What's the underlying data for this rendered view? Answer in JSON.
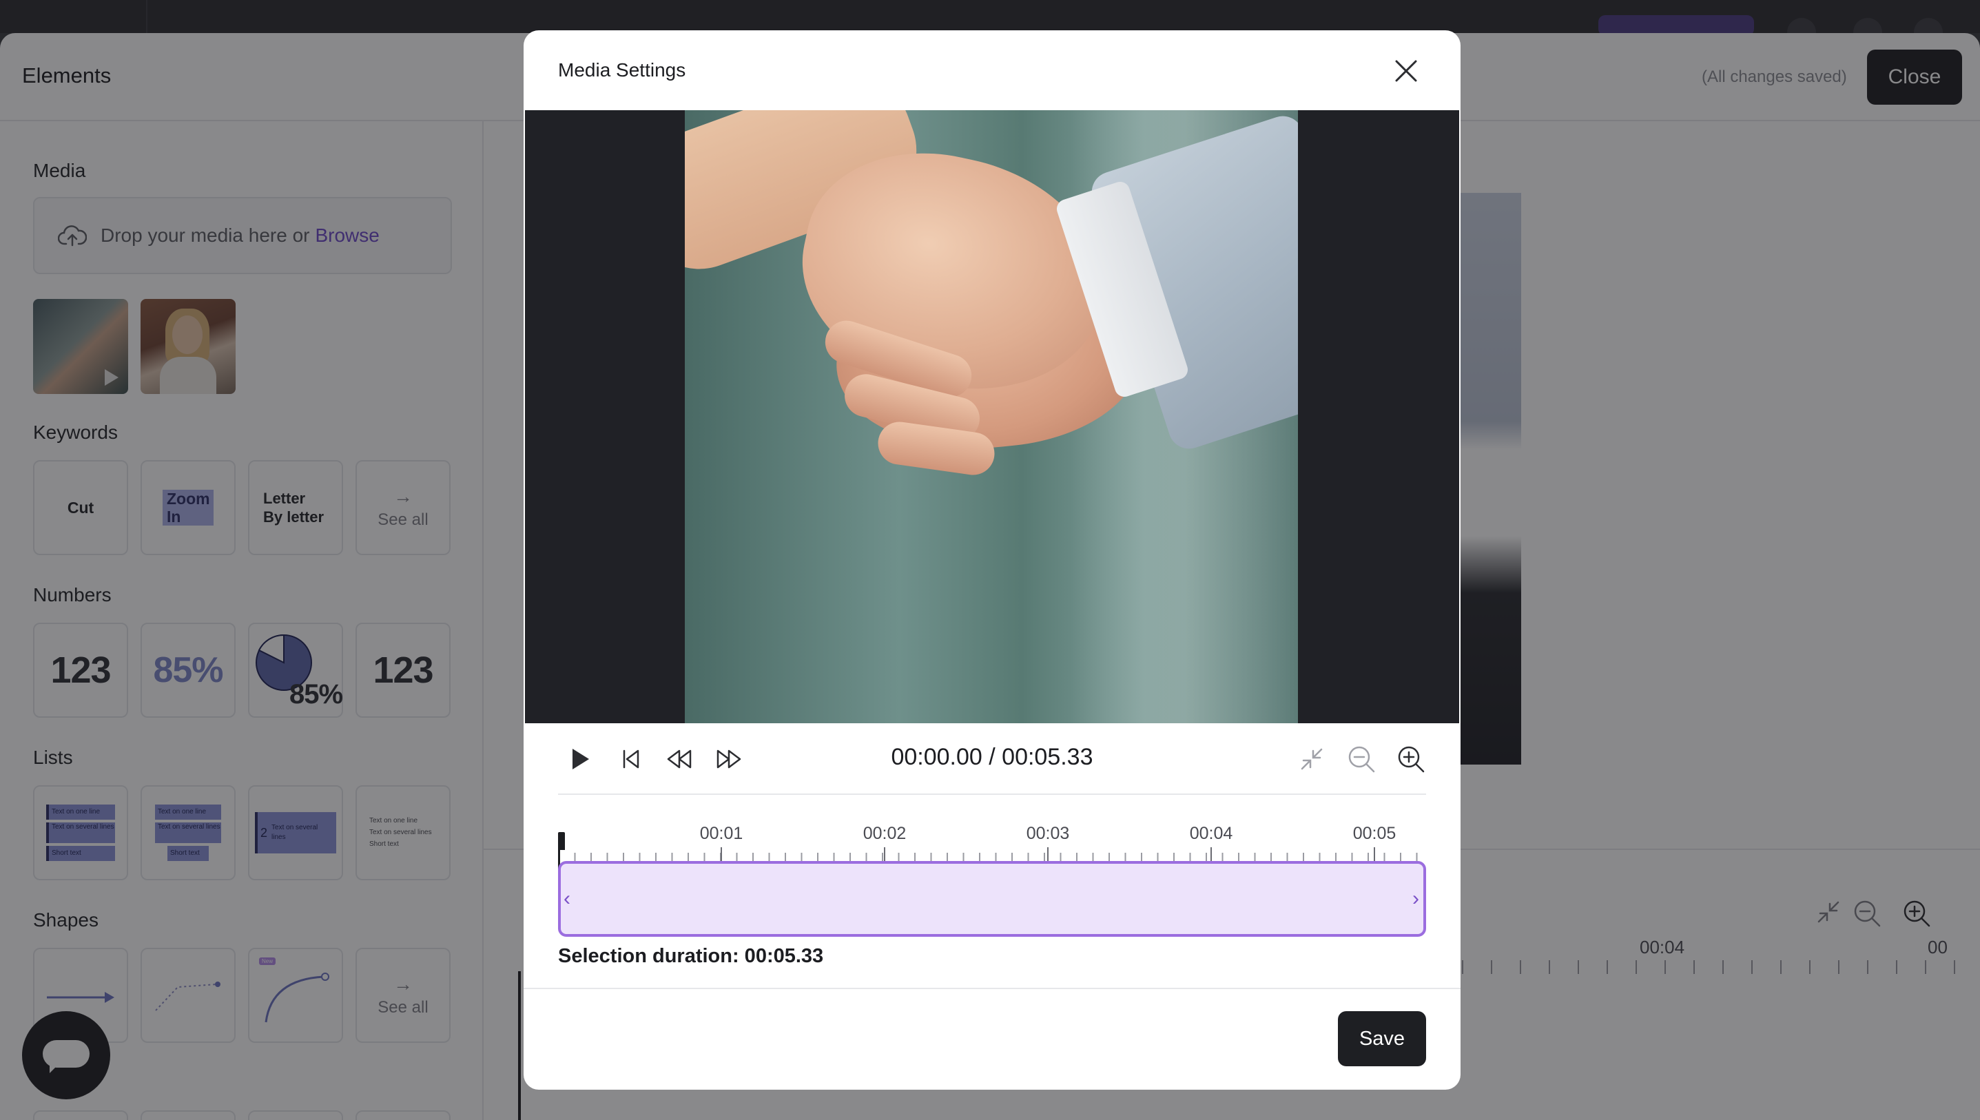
{
  "app": {
    "title": "Elements",
    "saved_status": "(All changes saved)",
    "close_label": "Close"
  },
  "sidebar": {
    "media": {
      "title": "Media",
      "drop_text": "Drop your media here or",
      "browse_label": "Browse"
    },
    "keywords": {
      "title": "Keywords",
      "items": [
        "Cut",
        "Zoom In",
        "Letter By letter"
      ],
      "see_all": "See all"
    },
    "numbers": {
      "title": "Numbers",
      "items": [
        "123",
        "85%",
        "85%",
        "123"
      ]
    },
    "lists": {
      "title": "Lists",
      "line_one": "Text on one line",
      "line_several": "Text on several lines",
      "short_text": "Short text",
      "numbered": "2"
    },
    "shapes": {
      "title": "Shapes",
      "new_badge": "New",
      "see_all": "See all"
    }
  },
  "background_timeline": {
    "labels": [
      "00:04",
      "00"
    ]
  },
  "modal": {
    "title": "Media Settings",
    "timecode": "00:00.00 / 00:05.33",
    "timeline_labels": [
      "00:01",
      "00:02",
      "00:03",
      "00:04",
      "00:05"
    ],
    "selection_duration": "Selection duration: 00:05.33",
    "save_label": "Save"
  },
  "colors": {
    "accent_purple": "#9b6ddf",
    "selection_fill": "#ede3fb",
    "dark_button": "#1e1f23",
    "link": "#6d49c9"
  }
}
